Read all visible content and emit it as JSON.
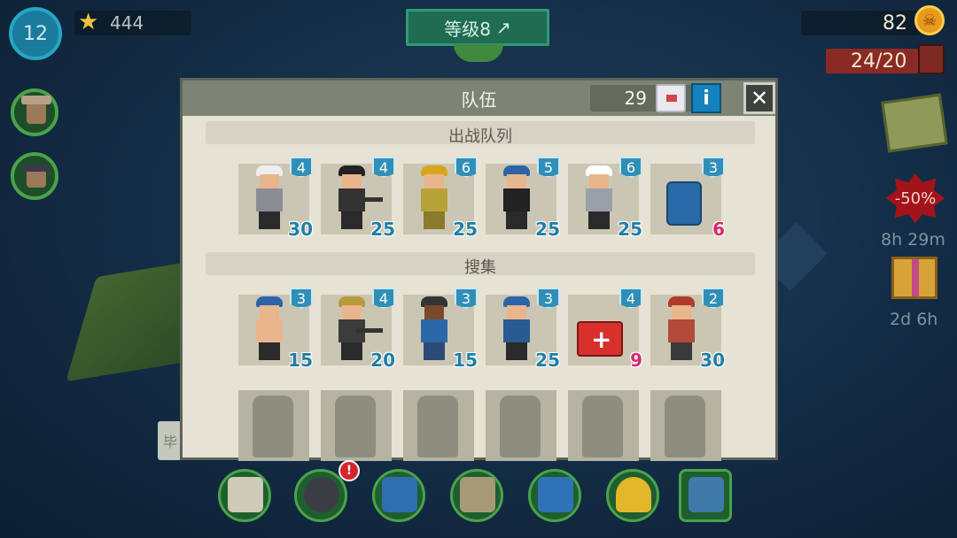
{
  "hud": {
    "player_level": "12",
    "stars": "444",
    "rank_label": "等级8",
    "coins": "82",
    "bag_capacity": "24/20"
  },
  "side": {
    "discount": "-50%",
    "discount_timer": "8h 29m",
    "gift_timer": "2d 6h"
  },
  "panel": {
    "title": "队伍",
    "tickets": "29",
    "info_label": "i",
    "close_label": "✕",
    "squad_title": "出战队列",
    "gather_title": "搜集",
    "side_tab_text": "毕"
  },
  "squad": [
    {
      "level": "4",
      "count": "30",
      "type": "survivor"
    },
    {
      "level": "4",
      "count": "25",
      "type": "police"
    },
    {
      "level": "6",
      "count": "25",
      "type": "builder"
    },
    {
      "level": "5",
      "count": "25",
      "type": "swat"
    },
    {
      "level": "6",
      "count": "25",
      "type": "mechanic"
    },
    {
      "level": "3",
      "count": "6",
      "type": "barrel"
    }
  ],
  "gather": [
    {
      "level": "3",
      "count": "15",
      "type": "digger"
    },
    {
      "level": "4",
      "count": "20",
      "type": "sniper"
    },
    {
      "level": "3",
      "count": "15",
      "type": "worker"
    },
    {
      "level": "3",
      "count": "25",
      "type": "cop"
    },
    {
      "level": "4",
      "count": "9",
      "type": "medkit"
    },
    {
      "level": "2",
      "count": "30",
      "type": "lumberjack"
    }
  ],
  "dock": [
    "skull-icon",
    "gamepad-icon",
    "radio-icon",
    "zombie-book-icon",
    "tools-icon",
    "helmet-icon",
    "crate-icon"
  ],
  "colors": {
    "accent": "#2f8fb8",
    "panel": "#e6e2d4",
    "header": "#7d8475"
  }
}
